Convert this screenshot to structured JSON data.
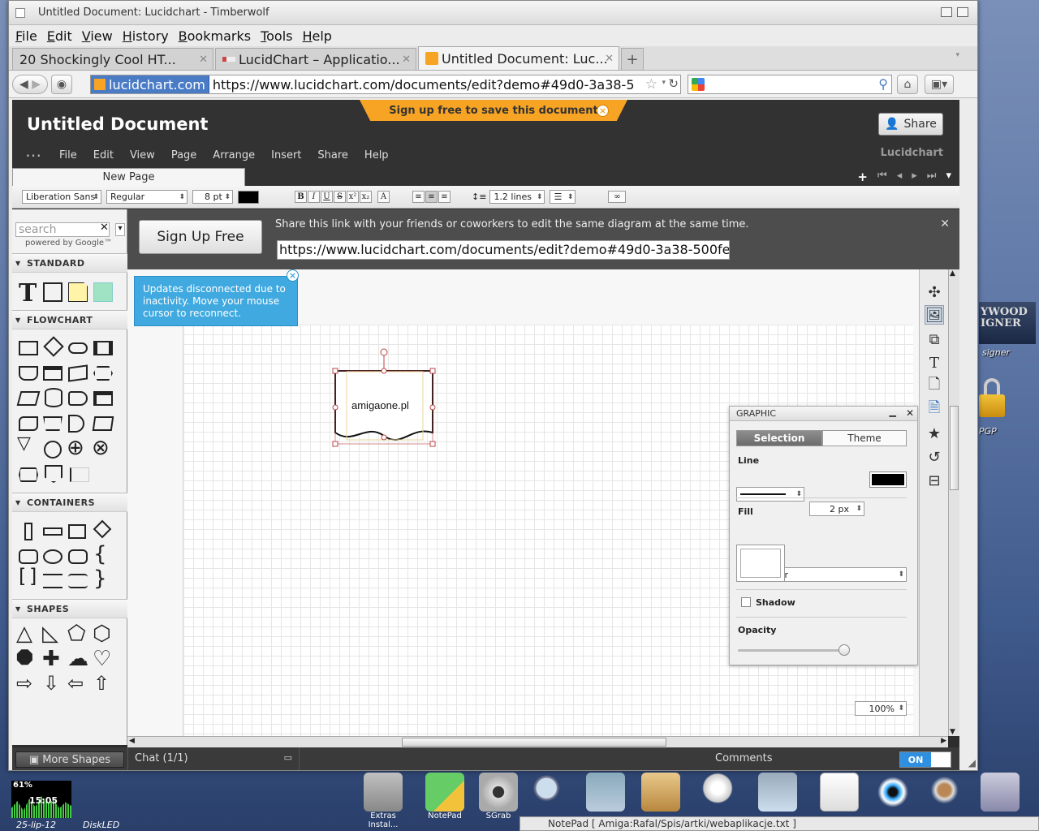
{
  "desktop": {
    "right_labels": [
      "signer",
      "PGP"
    ],
    "logo_text": "YWOOD\nIGNER",
    "cpu_meter": "61%",
    "clock": "15:05",
    "date": "25-lip-12",
    "diskled": "DiskLED",
    "dock": [
      {
        "label": "Extras Instal..."
      },
      {
        "label": "NotePad"
      },
      {
        "label": "SGrab"
      },
      {
        "label": ""
      },
      {
        "label": ""
      },
      {
        "label": ""
      },
      {
        "label": ""
      },
      {
        "label": ""
      },
      {
        "label": ""
      },
      {
        "label": ""
      },
      {
        "label": ""
      },
      {
        "label": ""
      }
    ],
    "notepad_window": "NotePad [ Amiga:Rafal/Spis/artki/webaplikacje.txt ]"
  },
  "browser": {
    "title": "Untitled Document: Lucidchart - Timberwolf",
    "menu": [
      "File",
      "Edit",
      "View",
      "History",
      "Bookmarks",
      "Tools",
      "Help"
    ],
    "tabs": [
      {
        "label": "20 Shockingly Cool HT...",
        "active": false
      },
      {
        "label": "LucidChart – Applicatio...",
        "active": false
      },
      {
        "label": "Untitled Document: Luc...",
        "active": true
      }
    ],
    "new_tab": "+",
    "site_badge": "lucidchart.com",
    "url": "https://www.lucidchart.com/documents/edit?demo#49d0-3a38-5"
  },
  "lucid": {
    "doc_title": "Untitled Document",
    "signup_banner": "Sign up free to save this document",
    "share_button": "Share",
    "menu": [
      "File",
      "Edit",
      "View",
      "Page",
      "Arrange",
      "Insert",
      "Share",
      "Help"
    ],
    "logo": "Lucidchart",
    "page_tab": "New Page",
    "toolbar": {
      "font": "Liberation Sans",
      "style": "Regular",
      "size": "8 pt",
      "line_spacing": "1.2 lines"
    },
    "search_placeholder": "search",
    "powered_by": "powered by Google™",
    "sections": [
      "STANDARD",
      "FLOWCHART",
      "CONTAINERS",
      "SHAPES"
    ],
    "signup_free": "Sign Up Free",
    "share_msg": "Share this link with your friends or coworkers to edit the same diagram at the same time.",
    "share_url": "https://www.lucidchart.com/documents/edit?demo#49d0-3a38-500fe",
    "notice": "Updates disconnected due to inactivity. Move your mouse cursor to reconnect.",
    "shape_text": "amigaone.pl",
    "graphic_panel": {
      "title": "GRAPHIC",
      "tab_selection": "Selection",
      "tab_theme": "Theme",
      "line_label": "Line",
      "line_width": "2 px",
      "fill_label": "Fill",
      "fill_type": "Solid Color",
      "shadow_label": "Shadow",
      "opacity_label": "Opacity",
      "opacity_value": "100%"
    },
    "more_shapes": "More Shapes",
    "chat": "Chat (1/1)",
    "comments": "Comments",
    "toggle": "ON"
  },
  "colors": {
    "accent_blue": "#3fa9e0",
    "banner_orange": "#f7a323",
    "toggle_blue": "#2f8fe0"
  }
}
